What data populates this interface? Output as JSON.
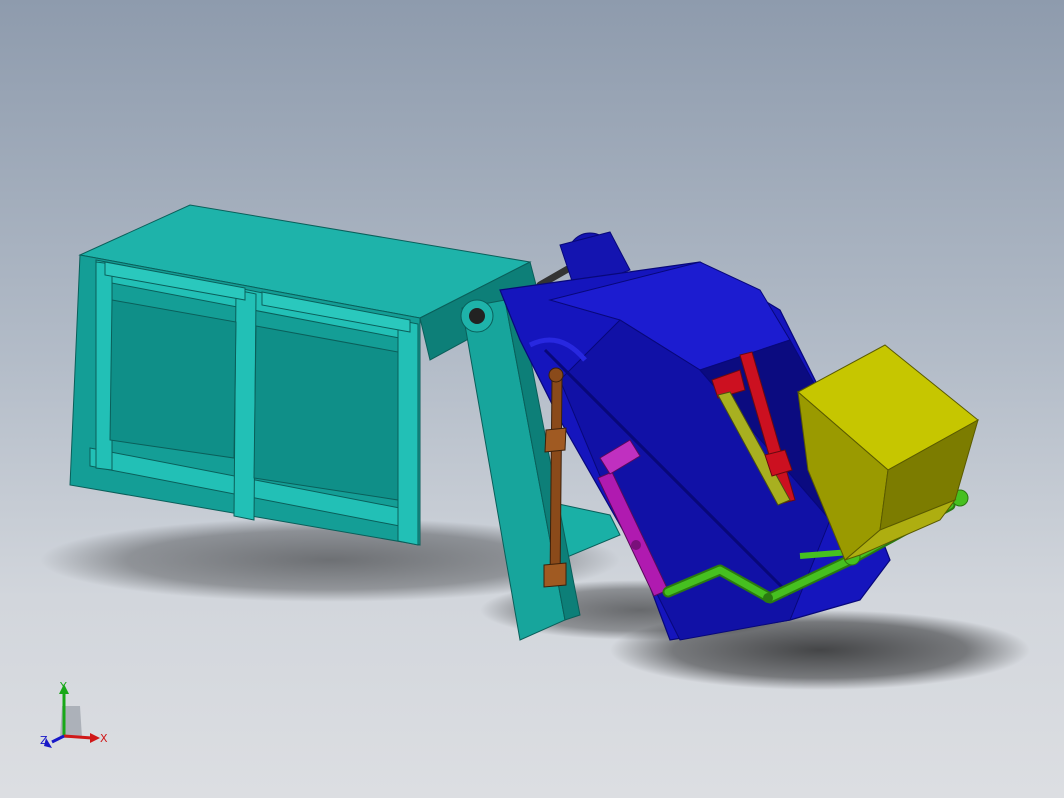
{
  "scene": {
    "background_top": "#8e9bad",
    "background_bottom": "#dcdee2",
    "parts": {
      "container_body": "#1aa9a0",
      "container_shadow": "#0d7f78",
      "tailgate_shell": "#1010b8",
      "tailgate_dark": "#08087a",
      "hopper": "#b8b800",
      "hopper_dark": "#7c7c00",
      "cylinder_brown": "#8a4a1a",
      "cylinder_red": "#cc1020",
      "cylinder_magenta": "#b01ab0",
      "linkage_green": "#3aa61a"
    }
  },
  "triad": {
    "x_label": "X",
    "y_label": "Y",
    "z_label": "Z",
    "x_color": "#d01818",
    "y_color": "#18a818",
    "z_color": "#1818c8"
  }
}
